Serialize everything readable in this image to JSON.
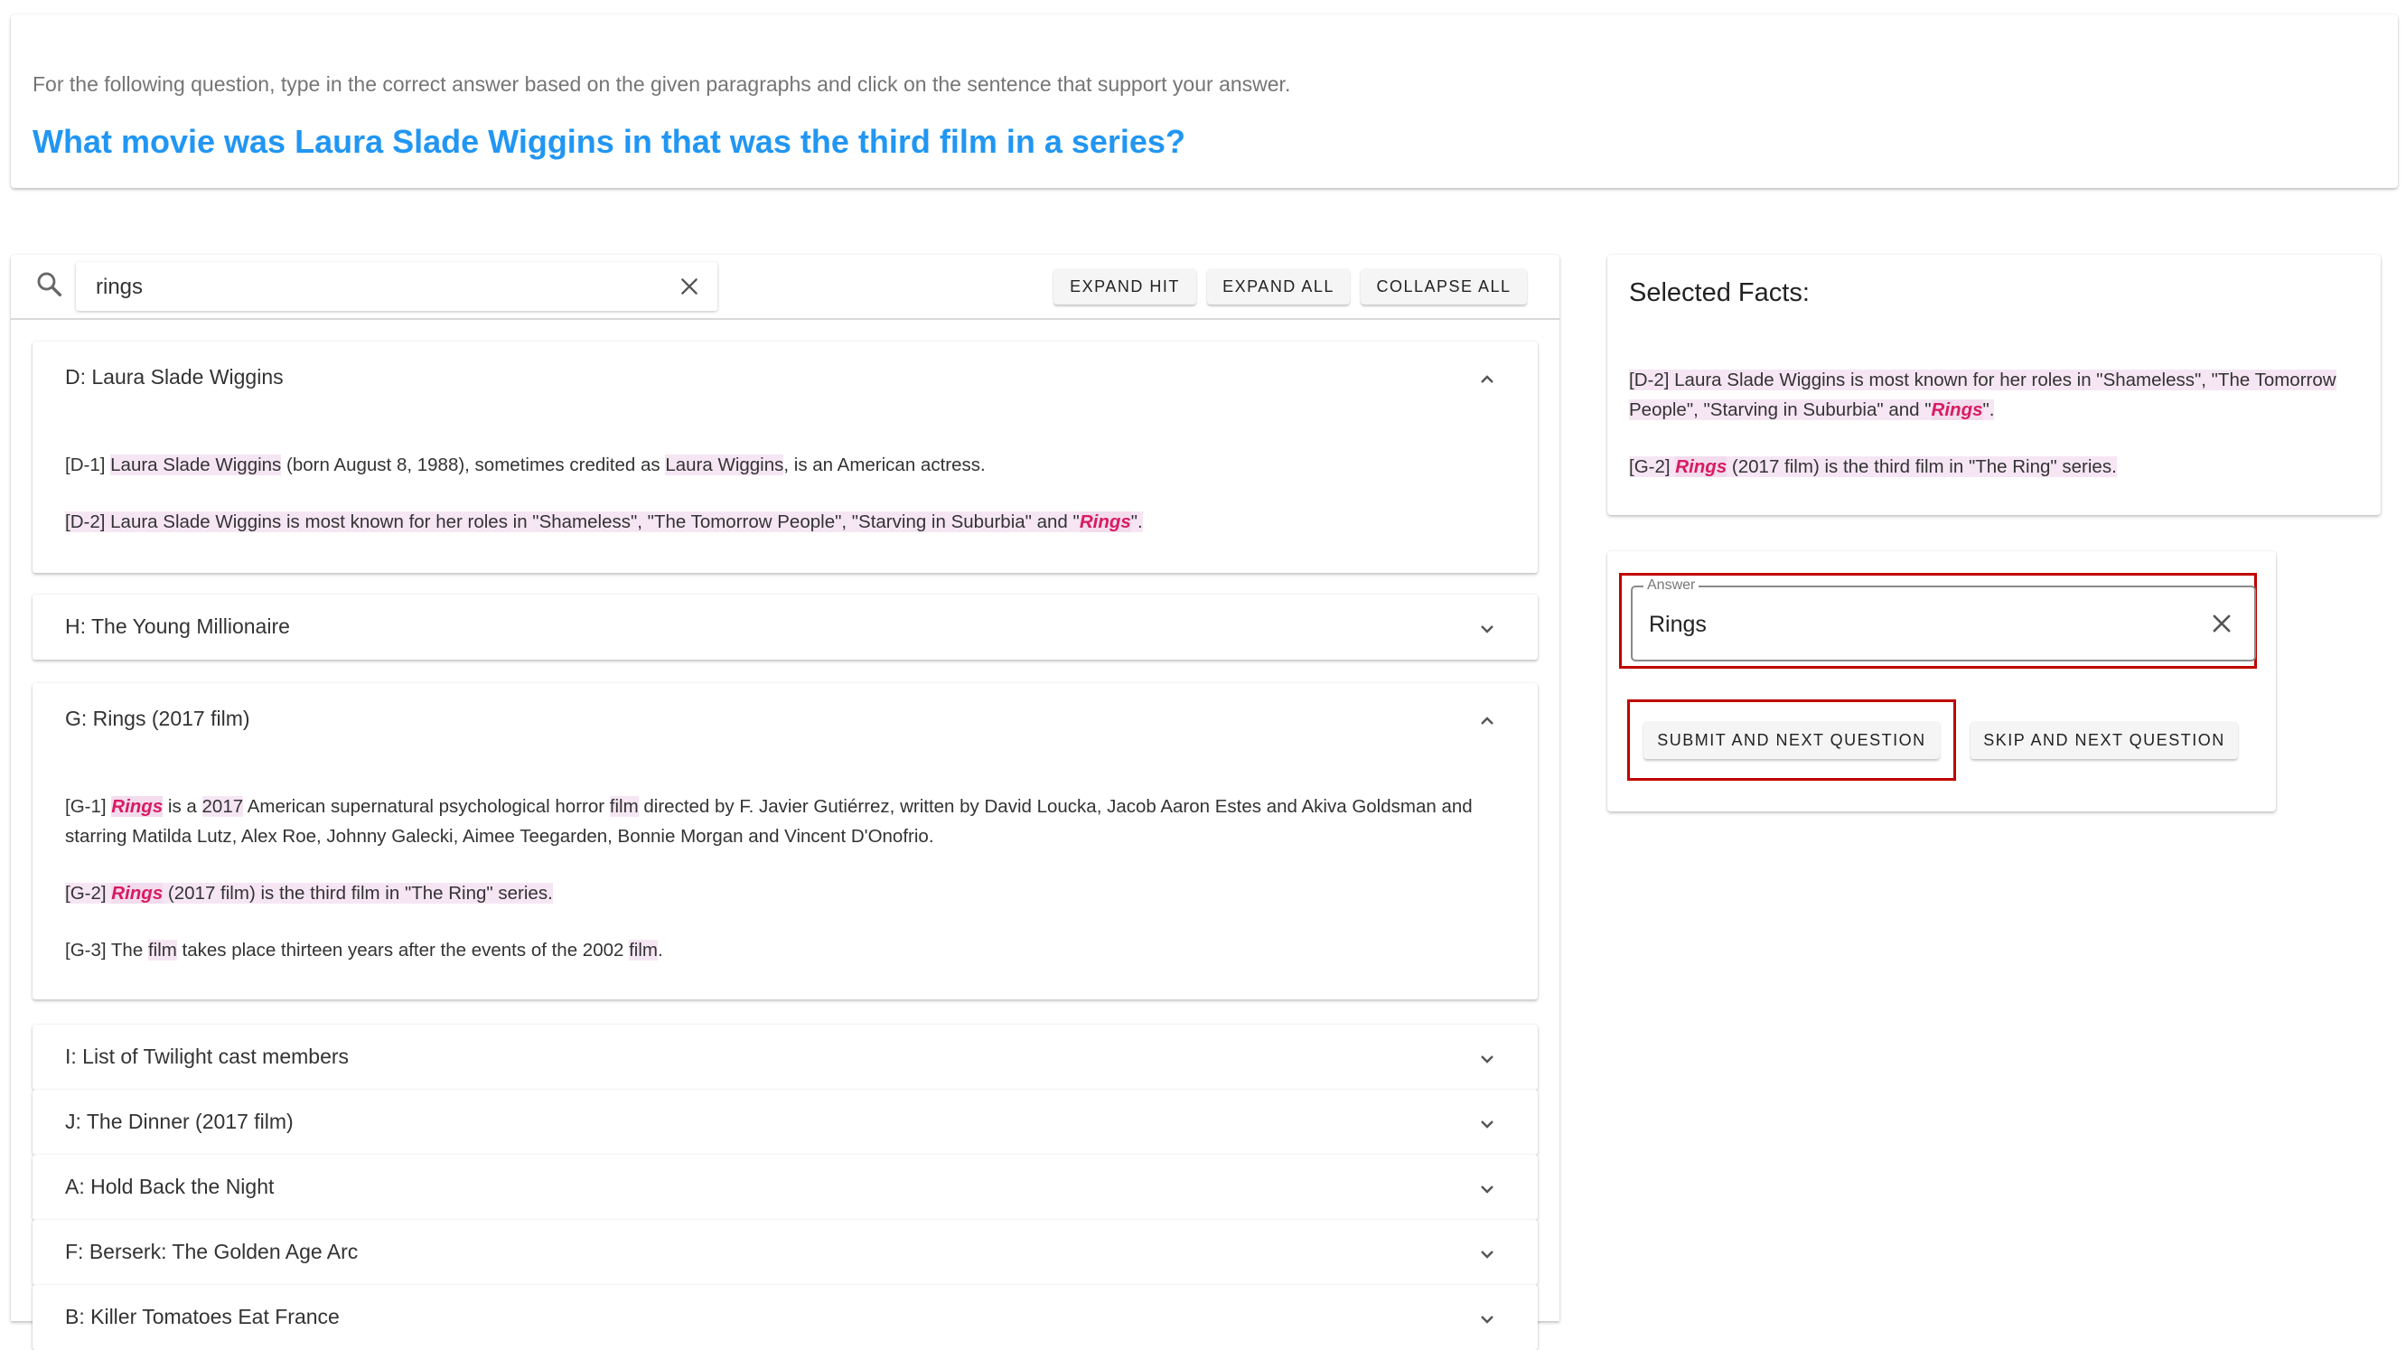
{
  "header": {
    "instruction": "For the following question, type in the correct answer based on the given paragraphs and click on the sentence that support your answer.",
    "question": "What movie was Laura Slade Wiggins in that was the third film in a series?"
  },
  "search": {
    "value": "rings",
    "icon": "search-icon",
    "clear_icon": "close-icon"
  },
  "toolbar": {
    "expand_hit": "Expand Hit",
    "expand_all": "Expand All",
    "collapse_all": "Collapse All"
  },
  "documents": [
    {
      "title": "D: Laura Slade Wiggins",
      "expanded": true,
      "sentences": [
        {
          "id": "[D-1]",
          "html": "<span class=\"hl\">Laura Slade Wiggins</span> (born August 8, 1988), sometimes credited as <span class=\"hl\">Laura Wiggins</span>, is an American actress."
        },
        {
          "id": "[D-2]",
          "html": "Laura Slade Wiggins is most known for her roles in \"Shameless\", \"The Tomorrow People\", \"Starving in Suburbia\" and \"<span class=\"kw\">Rings</span>\".",
          "selected": true
        }
      ]
    },
    {
      "title": "H: The Young Millionaire",
      "expanded": false
    },
    {
      "title": "G: Rings (2017 film)",
      "expanded": true,
      "sentences": [
        {
          "id": "[G-1]",
          "html": "<span class=\"kw\">Rings</span> is a <span class=\"hl\">2017</span> American supernatural psychological horror <span class=\"hl\">film</span> directed by F. Javier Gutiérrez, written by David Loucka, Jacob Aaron Estes and Akiva Goldsman and starring Matilda Lutz, Alex Roe, Johnny Galecki, Aimee Teegarden, Bonnie Morgan and Vincent D'Onofrio."
        },
        {
          "id": "[G-2]",
          "html": "<span class=\"kw\">Rings</span> (2017 film) is the third film in \"The Ring\" series.",
          "selected": true
        },
        {
          "id": "[G-3]",
          "html": "The <span class=\"hl\">film</span> takes place thirteen years after the events of the 2002 <span class=\"hl\">film</span>."
        }
      ]
    },
    {
      "title": "I: List of Twilight cast members",
      "expanded": false
    },
    {
      "title": "J: The Dinner (2017 film)",
      "expanded": false
    },
    {
      "title": "A: Hold Back the Night",
      "expanded": false
    },
    {
      "title": "F: Berserk: The Golden Age Arc",
      "expanded": false
    },
    {
      "title": "B: Killer Tomatoes Eat France",
      "expanded": false
    }
  ],
  "facts": {
    "title": "Selected Facts:",
    "items": [
      {
        "id": "[D-2]",
        "html": "Laura Slade Wiggins is most known for her roles in \"Shameless\", \"The Tomorrow People\", \"Starving in Suburbia\" and \"<span class=\"kw\">Rings</span>\"."
      },
      {
        "id": "[G-2]",
        "html": "<span class=\"kw\">Rings</span> (2017 film) is the third film in \"The Ring\" series."
      }
    ]
  },
  "answer": {
    "label": "Answer",
    "value": "Rings",
    "submit_label": "Submit and next question",
    "skip_label": "Skip and next question"
  },
  "colors": {
    "question": "#2196f3",
    "keyword": "#d81b60",
    "highlight": "#f6e6f4",
    "annotation_box": "#c00000"
  }
}
